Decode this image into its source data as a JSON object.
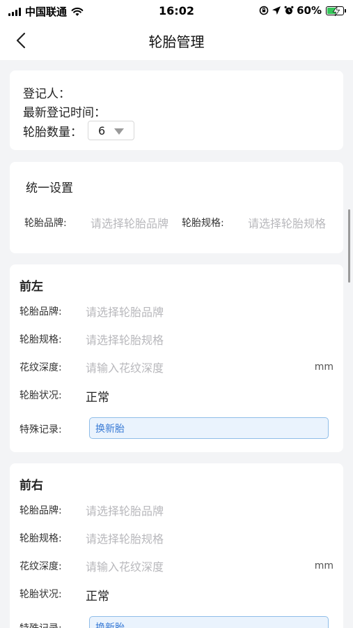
{
  "status_bar": {
    "carrier": "中国联通",
    "time": "16:02",
    "battery_percent": "60%",
    "battery_level": 0.6,
    "icons": [
      "signal-icon",
      "wifi-icon",
      "rotation-lock-icon",
      "location-icon",
      "alarm-icon",
      "battery-icon"
    ]
  },
  "nav": {
    "title": "轮胎管理",
    "back_icon": "chevron-left-icon"
  },
  "summary": {
    "registrant_label": "登记人：",
    "last_time_label": "最新登记时间：",
    "tire_count_label": "轮胎数量：",
    "tire_count_value": "6"
  },
  "unified": {
    "title": "统一设置",
    "brand_label": "轮胎品牌:",
    "brand_placeholder": "请选择轮胎品牌",
    "spec_label": "轮胎规格:",
    "spec_placeholder": "请选择轮胎规格"
  },
  "tires": [
    {
      "position": "前左",
      "brand_label": "轮胎品牌:",
      "brand_placeholder": "请选择轮胎品牌",
      "spec_label": "轮胎规格:",
      "spec_placeholder": "请选择轮胎规格",
      "depth_label": "花纹深度:",
      "depth_placeholder": "请输入花纹深度",
      "depth_unit": "mm",
      "status_label": "轮胎状况:",
      "status_value": "正常",
      "special_label": "特殊记录:",
      "special_value": "换新胎"
    },
    {
      "position": "前右",
      "brand_label": "轮胎品牌:",
      "brand_placeholder": "请选择轮胎品牌",
      "spec_label": "轮胎规格:",
      "spec_placeholder": "请选择轮胎规格",
      "depth_label": "花纹深度:",
      "depth_placeholder": "请输入花纹深度",
      "depth_unit": "mm",
      "status_label": "轮胎状况:",
      "status_value": "正常",
      "special_label": "特殊记录:",
      "special_value": "换新胎"
    }
  ],
  "colors": {
    "accent": "#3a7bd5",
    "background": "#f3f4f6",
    "placeholder": "#b8b8bc"
  }
}
